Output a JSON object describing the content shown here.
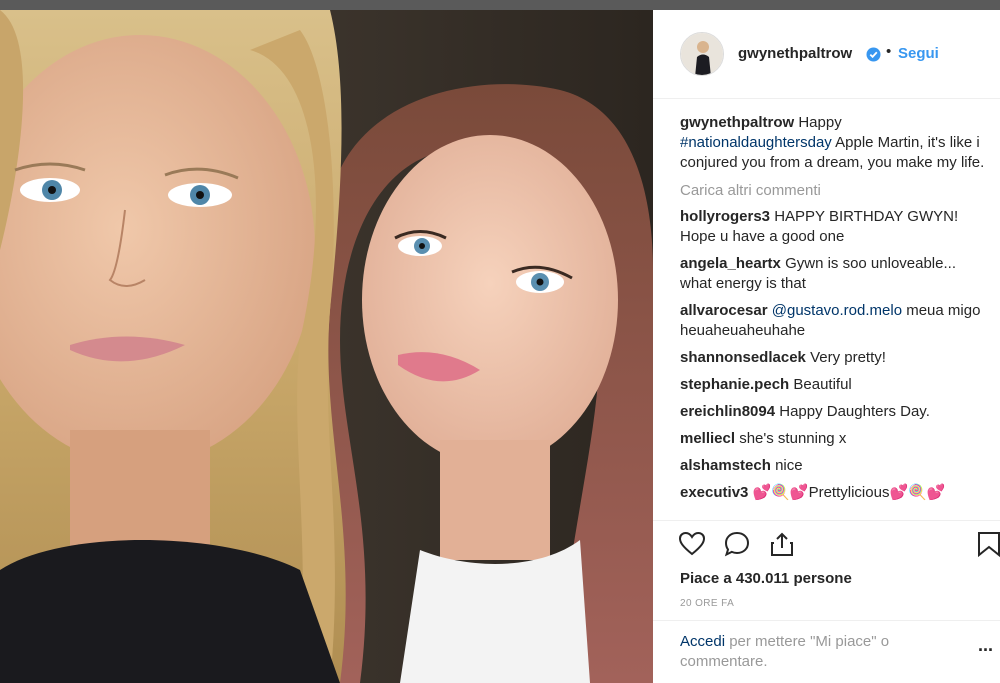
{
  "post": {
    "username": "gwynethpaltrow",
    "follow_label": "Segui",
    "separator": "•",
    "caption_user": "gwynethpaltrow",
    "caption_pre": "Happy",
    "caption_tag": "#nationaldaughtersday",
    "caption_post": "Apple Martin, it's like i conjured you from a dream, you make my life.",
    "load_more": "Carica altri commenti",
    "likes": "Piace a 430.011 persone",
    "time": "20 ORE FA",
    "login_link": "Accedi",
    "login_text": "per mettere \"Mi piace\" o commentare.",
    "more_label": "..."
  },
  "comments": [
    {
      "user": "hollyrogers3",
      "text": "HAPPY BIRTHDAY GWYN! Hope u have a good one"
    },
    {
      "user": "angela_heartx",
      "text": "Gywn is soo unloveable... what energy is that"
    },
    {
      "user": "allvarocesar",
      "mention": "@gustavo.rod.melo",
      "text": "meua migo heuaheuaheuhahe"
    },
    {
      "user": "shannonsedlacek",
      "text": "Very pretty!"
    },
    {
      "user": "stephanie.pech",
      "text": "Beautiful"
    },
    {
      "user": "ereichlin8094",
      "text": "Happy Daughters Day."
    },
    {
      "user": "melliecl",
      "text": "she's stunning x"
    },
    {
      "user": "alshamstech",
      "text": "nice"
    },
    {
      "user": "executiv3",
      "text": "💕🍭💕Prettylicious💕🍭💕"
    }
  ],
  "icons": {
    "like": "heart-icon",
    "comment": "comment-icon",
    "share": "share-icon",
    "save": "bookmark-icon",
    "verified": "verified-badge-icon"
  },
  "colors": {
    "link_blue": "#3897f0",
    "hashtag": "#003569",
    "muted": "#999999"
  }
}
